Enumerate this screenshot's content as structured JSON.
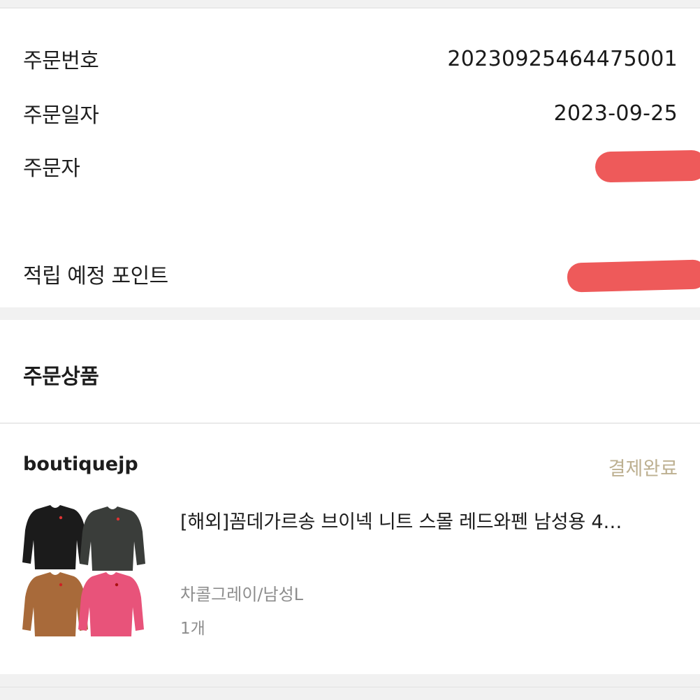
{
  "order_info": {
    "order_number_label": "주문번호",
    "order_number_value": "20230925464475001",
    "order_date_label": "주문일자",
    "order_date_value": "2023-09-25",
    "orderer_label": "주문자",
    "points_label": "적립 예정 포인트"
  },
  "products": {
    "section_title": "주문상품",
    "seller": "boutiquejp",
    "status": "결제완료",
    "item": {
      "name": "[해외]꼼데가르송 브이넥 니트 스몰 레드와펜 남성용 4…",
      "option": "차콜그레이/남성L",
      "quantity": "1개",
      "sweater_colors": [
        "#1b1b1b",
        "#3a3d3a",
        "#a86a3a",
        "#e8537a"
      ]
    }
  },
  "colors": {
    "status_text": "#bdb091",
    "redaction": "#ee5a5a"
  }
}
